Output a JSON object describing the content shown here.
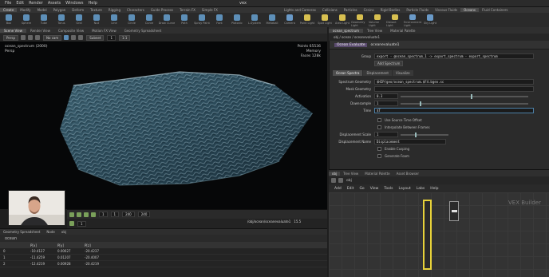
{
  "menubar": {
    "items": [
      "File",
      "Edit",
      "Render",
      "Assets",
      "Windows",
      "Help"
    ],
    "title": "vex"
  },
  "shelf_left": {
    "tabs": [
      "Create",
      "Modify",
      "Model",
      "Polygon",
      "Deform",
      "Texture",
      "Rigging",
      "Characters",
      "Guide Process",
      "Terrain FX",
      "Simple FX"
    ],
    "active_tab": 0,
    "tools": [
      "Box",
      "Sphere",
      "Tube",
      "Torus",
      "Grid",
      "Null",
      "Line",
      "Circle",
      "Curve",
      "Draw Curve",
      "Path",
      "Spray Paint",
      "Font",
      "Platonic",
      "L-System",
      "Metaball",
      "File"
    ]
  },
  "shelf_right": {
    "tabs": [
      "Lights and Cameras",
      "Collisions",
      "Particles",
      "Grains",
      "Rigid Bodies",
      "Particle Fluids",
      "Viscous Fluids",
      "Oceans",
      "Fluid Containers",
      "Populate Containers"
    ],
    "active_tab": 7,
    "tools": [
      "Camera",
      "Point Light",
      "Spot Light",
      "Area Light",
      "Geometry Light",
      "Volume Light",
      "Distant Light",
      "Environment Light",
      "Sky Light"
    ]
  },
  "viewport": {
    "tabs": [
      "Scene View",
      "Render View",
      "Composite View",
      "Motion FX View",
      "Geometry Spreadsheet"
    ],
    "active_tab": 0,
    "toolbar": {
      "context": "Persp",
      "camera": "No cam",
      "field_label": "Subnet",
      "field_value": "1",
      "zoom": "1:1"
    },
    "overlay_left": [
      "ocean_spectrum (2000)",
      "Persp"
    ],
    "overlay_right": [
      "Points 65536",
      "Memory",
      "Faces 128k"
    ]
  },
  "timeline": {
    "frame": "1",
    "start": "1",
    "end": "240",
    "range_end": "240",
    "frame2": "1"
  },
  "status": {
    "path": "/obj/ocean/oceanevaluate1",
    "version": "15.5"
  },
  "sheet": {
    "tabs": [
      "Geometry Spreadsheet",
      "Node",
      "obj"
    ],
    "node": "ocean",
    "headers": [
      "",
      "P[x]",
      "P[y]",
      "P[z]"
    ],
    "rows": [
      [
        "0",
        "-10.4127",
        "0.00627",
        "-20.4237"
      ],
      [
        "1",
        "-11.4259",
        "0.01207",
        "-20.4007"
      ],
      [
        "2",
        "-12.4219",
        "0.00928",
        "-20.4219"
      ]
    ]
  },
  "params_pane": {
    "tabs": [
      "ocean_spectrum",
      "Tree View",
      "Material Palette"
    ],
    "active_tab": 0,
    "path": "obj / ocean / oceanevaluate1",
    "node_type": "Ocean Evaluate",
    "node_name": "oceanevaluate1",
    "group_label": "Group",
    "group_value": "export - @ocean_spectrum_1 -> export_spectrum - export_spectrum",
    "group_button": "Add Spectrum",
    "subtabs": [
      "Ocean Spectra",
      "Displacement",
      "Visualize"
    ],
    "active_subtab": 0,
    "parameters": [
      {
        "label": "Spectrum Geometry",
        "value": "$HIP/geo/ocean_spectrum.$F4.bgeo.sc",
        "slider": null
      },
      {
        "label": "Mask Geometry",
        "value": "",
        "slider": null
      },
      {
        "label": "Activation",
        "value": "0.3",
        "slider": 0.55
      },
      {
        "label": "Downsample",
        "value": "1",
        "slider": 0.15
      },
      {
        "label": "Time",
        "value": "$T",
        "slider": null
      }
    ],
    "checks": [
      "Use Source Time Offset",
      "Interpolate Between Frames"
    ],
    "extra_params": [
      {
        "label": "Displacement Scale",
        "value": "1",
        "slider": 0.3
      },
      {
        "label": "Displacement Name",
        "value": "Displacement",
        "slider": null
      }
    ],
    "more_checks": [
      "Enable Cusping",
      "Generate Foam"
    ]
  },
  "network": {
    "tabs": [
      "obj",
      "Tree View",
      "Material Palette",
      "Asset Browser"
    ],
    "active_tab": 0,
    "path": "obj",
    "menu": [
      "Add",
      "Edit",
      "Go",
      "View",
      "Tools",
      "Layout",
      "Labs",
      "Help"
    ],
    "label": "VEX Builder"
  }
}
